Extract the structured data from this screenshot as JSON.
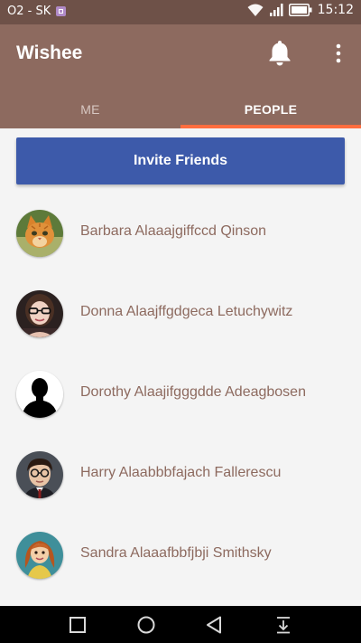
{
  "status_bar": {
    "carrier": "O2 - SK",
    "time": "15:12"
  },
  "app_bar": {
    "title": "Wishee",
    "notification_icon": "bell-icon",
    "menu_icon": "overflow-menu-icon"
  },
  "tabs": [
    {
      "label": "ME",
      "selected": false
    },
    {
      "label": "PEOPLE",
      "selected": true
    }
  ],
  "invite_button": {
    "label": "Invite Friends"
  },
  "people": [
    {
      "name": "Barbara Alaaajgiffccd Qinson",
      "avatar": "cat-photo"
    },
    {
      "name": "Donna Alaajffgdgeca Letuchywitz",
      "avatar": "woman-with-glasses-photo"
    },
    {
      "name": "Dorothy Alaajifgggdde Adeagbosen",
      "avatar": "default-silhouette"
    },
    {
      "name": "Harry Alaabbbfajach Fallerescu",
      "avatar": "boy-with-glasses-photo"
    },
    {
      "name": "Sandra Alaaafbbfjbji Smithsky",
      "avatar": "cartoon-girl"
    }
  ],
  "colors": {
    "status_bar": "#6e5148",
    "app_bar": "#8d6a5f",
    "tab_indicator": "#ff6d3f",
    "invite_button": "#3d5aaa",
    "name_text": "#8d6a5f",
    "background": "#f4f4f4"
  }
}
